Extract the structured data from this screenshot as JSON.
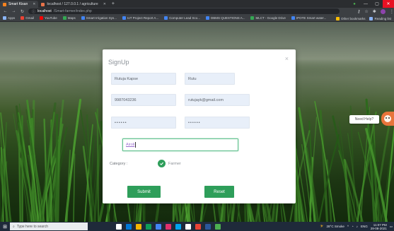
{
  "browser": {
    "tabs": [
      {
        "label": "Smart Kisan",
        "color": "#f6821f",
        "active": true
      },
      {
        "label": "localhost / 127.0.0.1 / agriculture",
        "color": "#e8734a",
        "active": false
      }
    ],
    "new_tab": "+",
    "url_host": "localhost",
    "url_path": "/Smart-farmer/index.php",
    "bookmarks": [
      {
        "label": "Apps",
        "color": "#8ab4f8"
      },
      {
        "label": "Gmail",
        "color": "#ea4335"
      },
      {
        "label": "YouTube",
        "color": "#ff0000"
      },
      {
        "label": "Maps",
        "color": "#34a853"
      },
      {
        "label": "Smart Irrigation Sys...",
        "color": "#4285f4"
      },
      {
        "label": "IoT Project Report A...",
        "color": "#4285f4"
      },
      {
        "label": "Computer Lead Sco...",
        "color": "#4285f4"
      },
      {
        "label": "DBMS QUESTIONS A...",
        "color": "#4285f4"
      },
      {
        "label": "MLCT - Google Drive",
        "color": "#34a853"
      },
      {
        "label": "IPOTE Smart water...",
        "color": "#4285f4"
      }
    ],
    "bookmarks_right": [
      {
        "label": "Other bookmarks",
        "color": "#fbbc04"
      },
      {
        "label": "Reading list",
        "color": "#8ab4f8"
      }
    ]
  },
  "modal": {
    "title": "SignUp",
    "close": "×",
    "first_name": "Rutuja Kapse",
    "last_name": "Rutu",
    "phone": "9987043236",
    "email": "rutujayk@gmail.com",
    "password": "••••••",
    "confirm_password": "••••••",
    "city": "Airoli",
    "category_label": "Category :",
    "category_option": "Farmer",
    "submit": "Submit",
    "reset": "Reset"
  },
  "help": {
    "label": "Need Help?"
  },
  "taskbar": {
    "search_placeholder": "Type here to search",
    "weather": "28°C Smoke",
    "lang": "ENG",
    "time": "11:07 PM",
    "date": "29-08-2021",
    "app_colors": [
      "#ffffff",
      "#0078d7",
      "#f4b400",
      "#0f9d58",
      "#4285f4",
      "#e1306c",
      "#00a4ef",
      "#ffffff",
      "#ea4335",
      "#2b579a",
      "#4caf50"
    ]
  },
  "colors": {
    "accent_green": "#2e9e5a",
    "field_bg": "#e8eff9",
    "focus_border": "#5cbf8a"
  }
}
